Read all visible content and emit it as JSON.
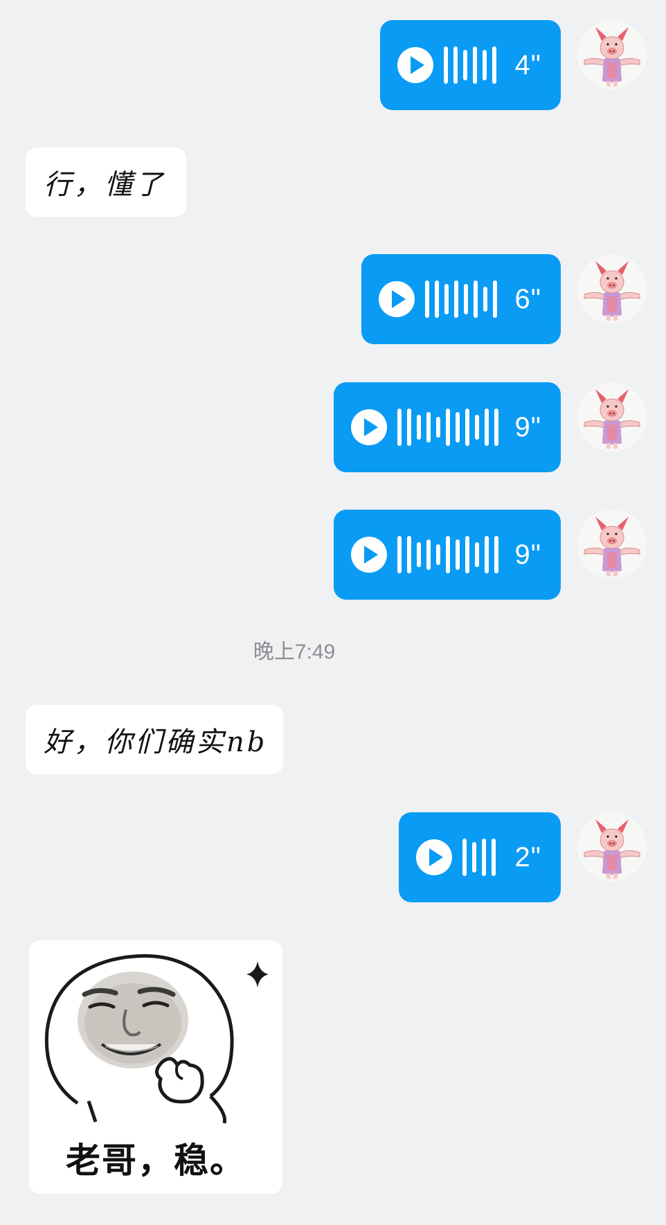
{
  "messages": {
    "m1": {
      "type": "voice",
      "side": "right",
      "duration": "4\""
    },
    "m2": {
      "type": "text",
      "side": "left",
      "text": "行，懂了"
    },
    "m3": {
      "type": "voice",
      "side": "right",
      "duration": "6\""
    },
    "m4": {
      "type": "voice",
      "side": "right",
      "duration": "9\""
    },
    "m5": {
      "type": "voice",
      "side": "right",
      "duration": "9\""
    },
    "m6": {
      "type": "text",
      "side": "left",
      "text": "好，你们确实nb"
    },
    "m7": {
      "type": "voice",
      "side": "right",
      "duration": "2\""
    },
    "m8": {
      "type": "sticker",
      "side": "left",
      "caption": "老哥，稳。"
    }
  },
  "timestamp": "晚上7:49",
  "colors": {
    "background": "#f0f1f3",
    "voice_bubble": "#0a9bf4",
    "text_bubble": "#ffffff",
    "timestamp": "#8d8d92"
  },
  "icons": {
    "avatar": "piglet-avatar-icon",
    "play": "play-icon",
    "waveform": "voice-waveform-icon",
    "sticker_sparkle": "sparkle-icon"
  }
}
